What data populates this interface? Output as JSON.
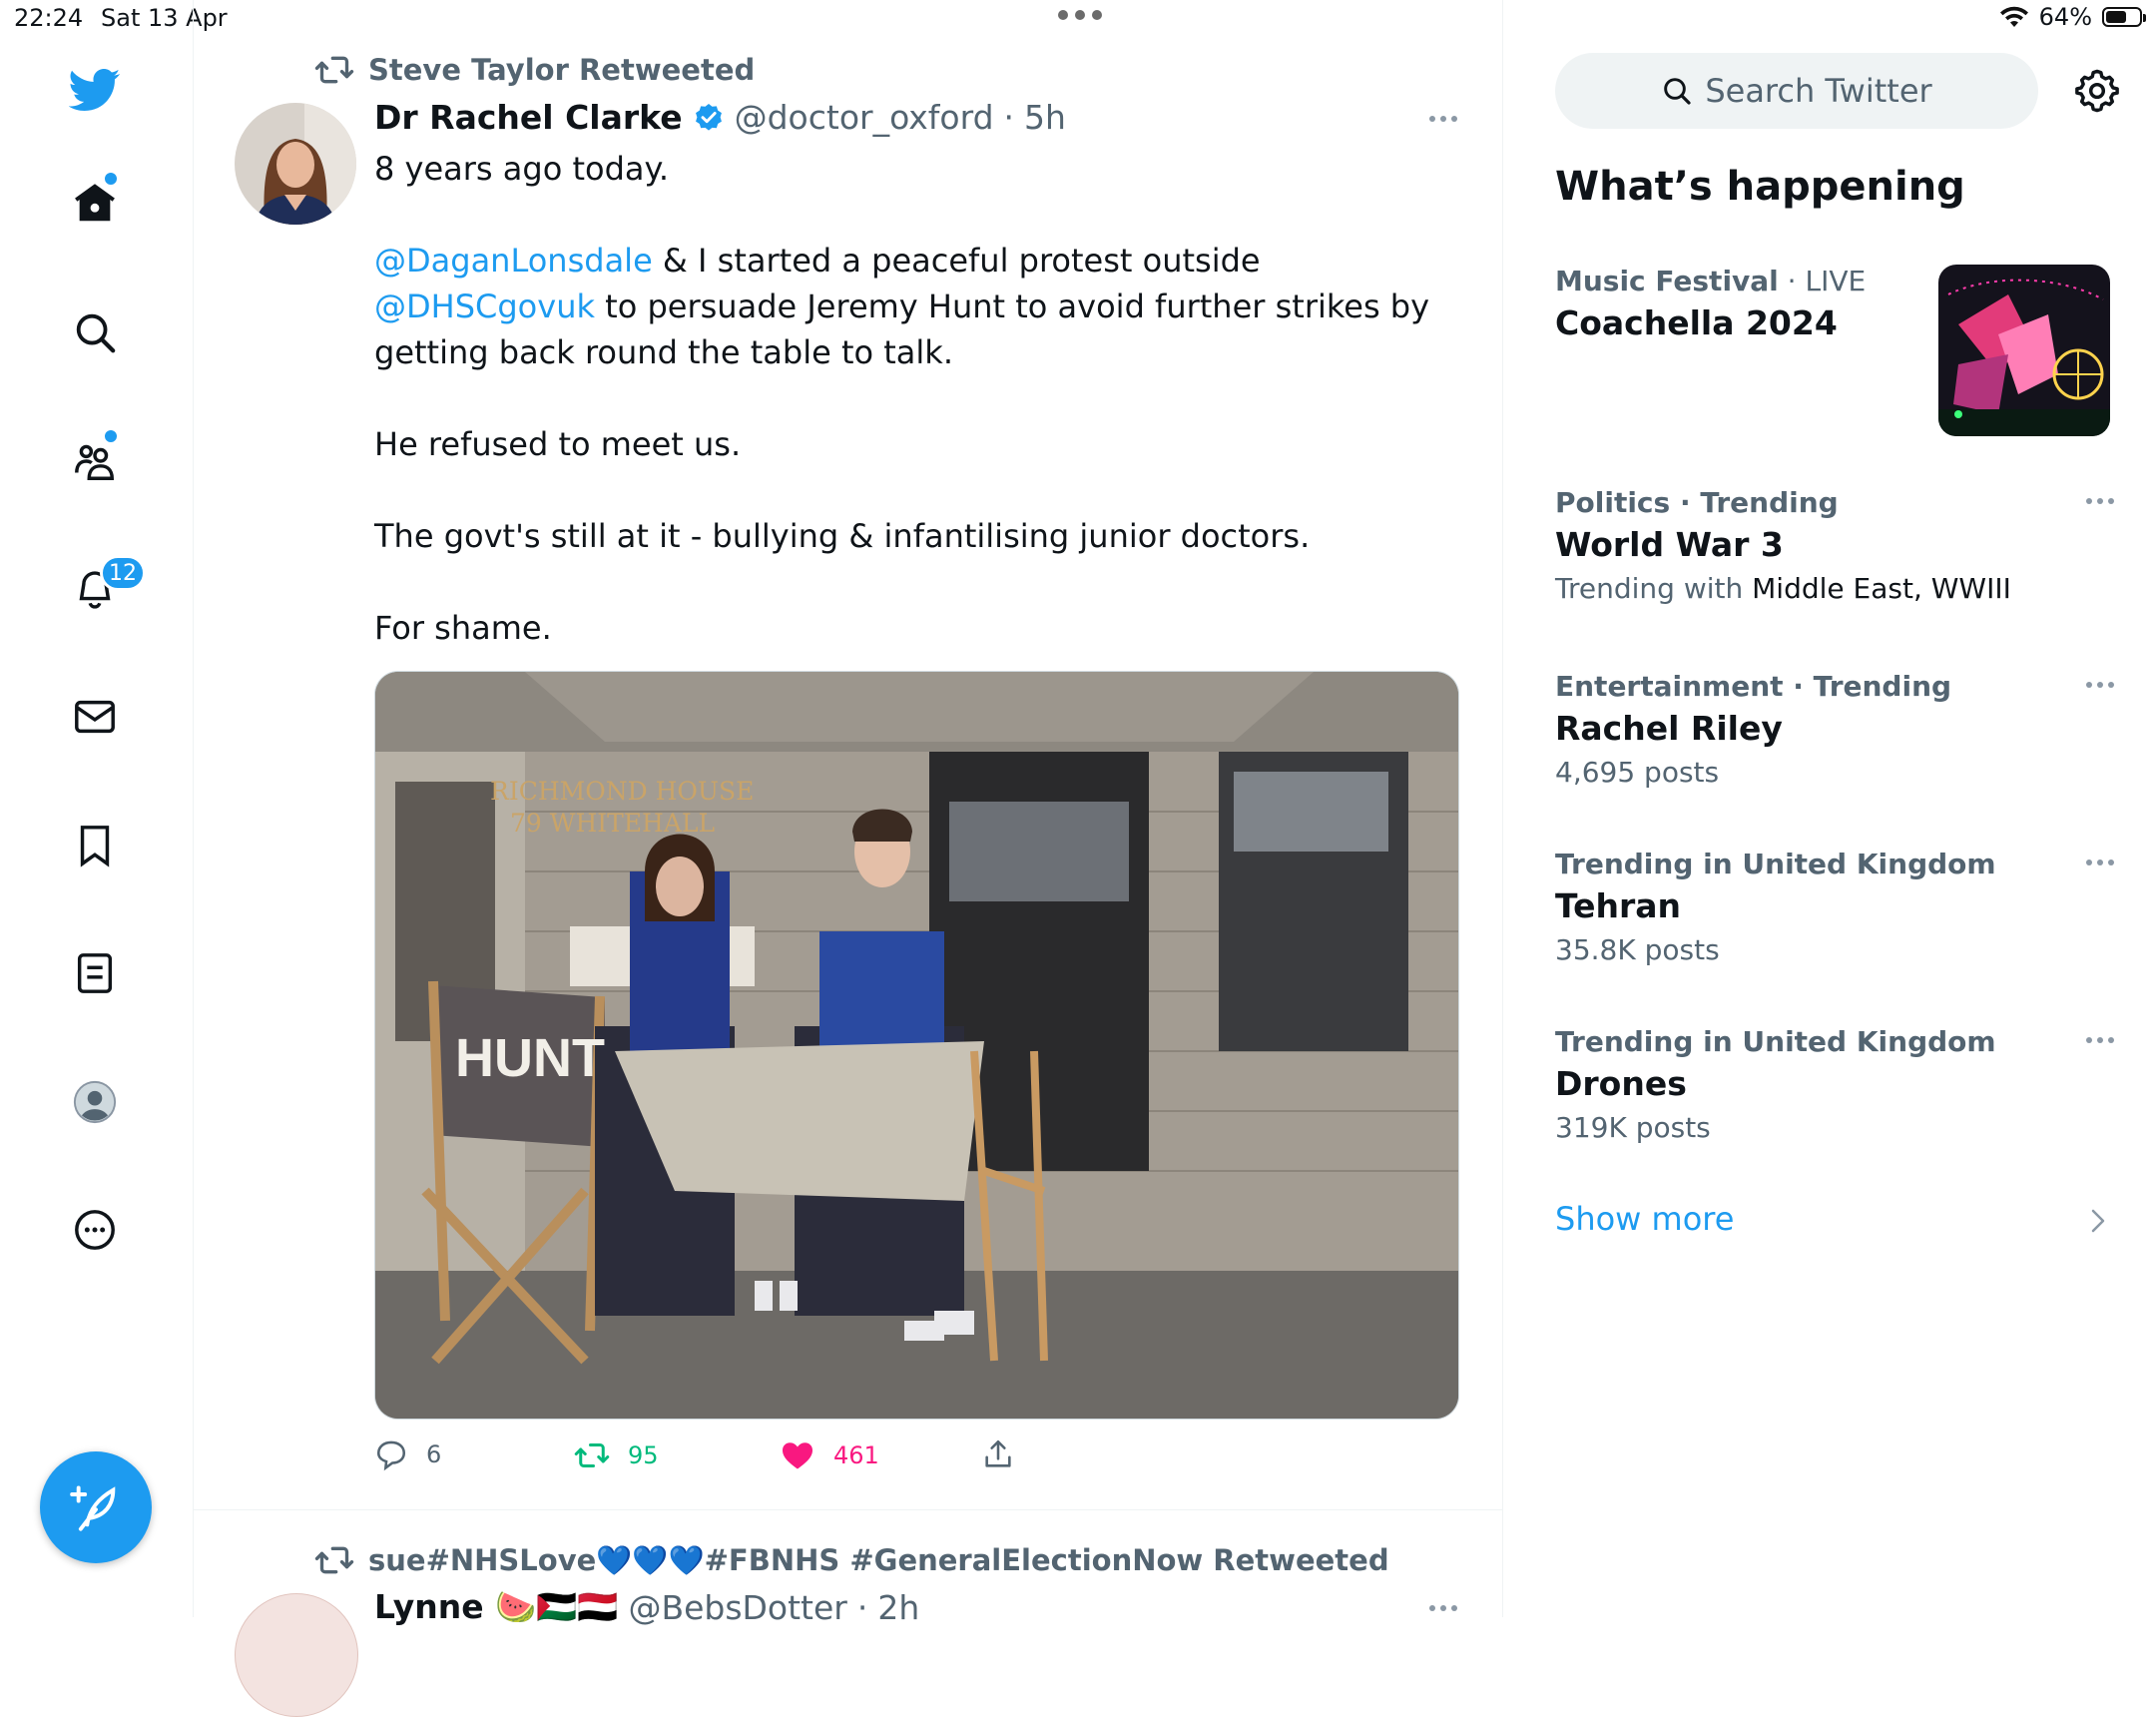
{
  "status": {
    "time": "22:24",
    "date": "Sat 13 Apr",
    "battery": "64%",
    "battery_level": 0.64
  },
  "sidebar": {
    "items": [
      {
        "icon": "twitter-bird-icon"
      },
      {
        "icon": "home-icon",
        "has_dot": true
      },
      {
        "icon": "search-icon"
      },
      {
        "icon": "communities-icon",
        "has_dot": true
      },
      {
        "icon": "notifications-bell-icon",
        "badge": "12"
      },
      {
        "icon": "messages-envelope-icon"
      },
      {
        "icon": "bookmark-icon"
      },
      {
        "icon": "lists-icon"
      },
      {
        "icon": "profile-avatar-icon"
      },
      {
        "icon": "more-circle-icon"
      }
    ],
    "compose_icon": "compose-feather-icon"
  },
  "tweet": {
    "retweeted_by": "Steve Taylor Retweeted",
    "author_name": "Dr Rachel Clarke",
    "author_handle": "@doctor_oxford",
    "separator": "·",
    "time": "5h",
    "line1": "8 years ago today.",
    "mention1": "@DaganLonsdale",
    "text_mid": " & I started a peaceful protest outside ",
    "mention2": "@DHSCgovuk",
    "text_end": " to persuade Jeremy Hunt to avoid further strikes by getting back round the table to talk.",
    "line3": "He refused to meet us.",
    "line4": "The govt's still at it - bullying & infantilising junior doctors.",
    "line5": "For shame.",
    "image": {
      "building_sign_line1": "RICHMOND HOUSE",
      "building_sign_line2": "79 WHITEHALL",
      "chair_text": "HUNT"
    },
    "replies": "6",
    "retweets": "95",
    "likes": "461",
    "colors": {
      "retweet": "#00ba7c",
      "like": "#f91880",
      "link": "#1d9bf0"
    }
  },
  "next_tweet": {
    "retweeted_by": "sue#NHSLove💙💙💙#FBNHS #GeneralElectionNow Retweeted",
    "author_name": "Lynne 🍉🇵🇸🇾🇪",
    "author_handle": "@BebsDotter",
    "separator": "·",
    "time": "2h"
  },
  "right": {
    "search_placeholder": "Search Twitter",
    "section_title": "What’s happening",
    "trends": [
      {
        "category": "Music Festival",
        "sep": " · ",
        "status": "LIVE",
        "title": "Coachella 2024",
        "has_image": true
      },
      {
        "category": "Politics · Trending",
        "title": "World War 3",
        "sub_prefix": "Trending with ",
        "sub_dark": "Middle East, WWIII"
      },
      {
        "category": "Entertainment · Trending",
        "title": "Rachel Riley",
        "sub": "4,695 posts"
      },
      {
        "category": "Trending in United Kingdom",
        "title": "Tehran",
        "sub": "35.8K posts"
      },
      {
        "category": "Trending in United Kingdom",
        "title": "Drones",
        "sub": "319K posts"
      }
    ],
    "show_more": "Show more"
  }
}
